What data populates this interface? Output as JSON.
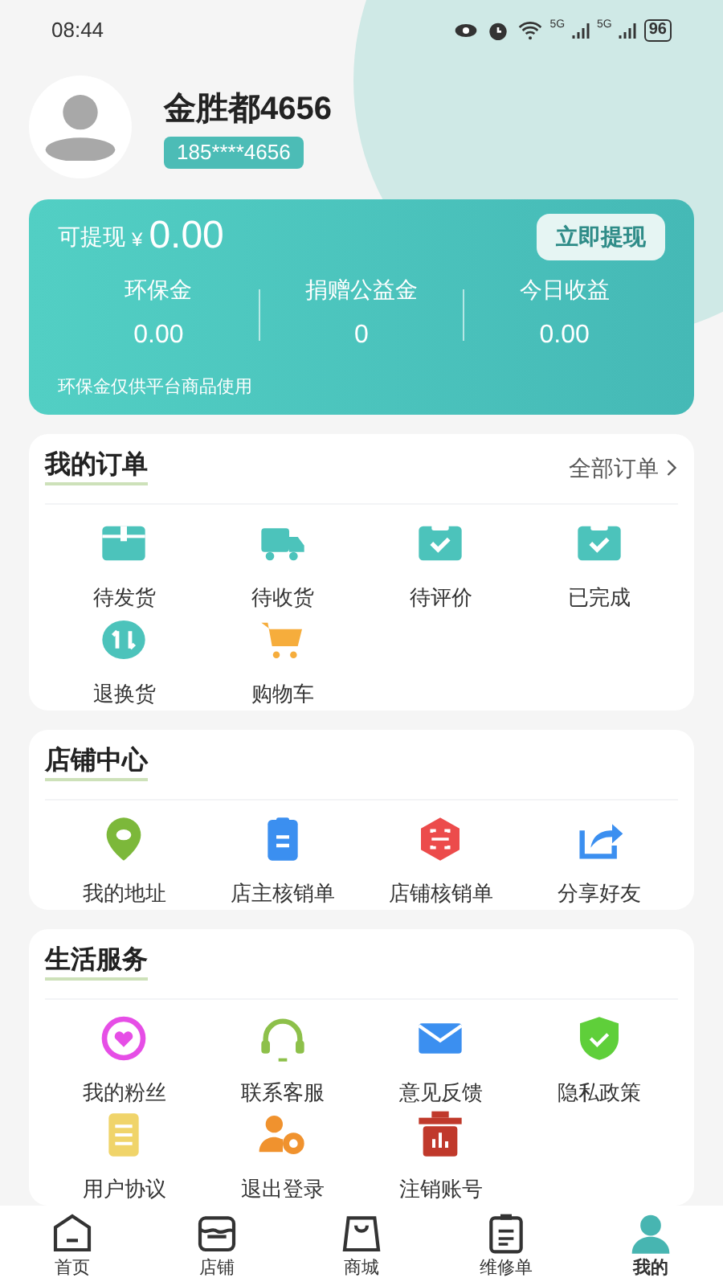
{
  "status_bar": {
    "time": "08:44",
    "network_1": "5G",
    "network_2": "5G",
    "battery": "96"
  },
  "profile": {
    "name": "金胜都4656",
    "phone": "185****4656"
  },
  "wallet": {
    "label": "可提现",
    "currency": "¥",
    "amount": "0.00",
    "withdraw_button": "立即提现",
    "stats": [
      {
        "label": "环保金",
        "value": "0.00"
      },
      {
        "label": "捐赠公益金",
        "value": "0"
      },
      {
        "label": "今日收益",
        "value": "0.00"
      }
    ],
    "note": "环保金仅供平台商品使用"
  },
  "orders": {
    "title": "我的订单",
    "more": "全部订单",
    "items": [
      "待发货",
      "待收货",
      "待评价",
      "已完成",
      "退换货",
      "购物车"
    ]
  },
  "store_center": {
    "title": "店铺中心",
    "items": [
      "我的地址",
      "店主核销单",
      "店铺核销单",
      "分享好友"
    ]
  },
  "life_services": {
    "title": "生活服务",
    "items": [
      "我的粉丝",
      "联系客服",
      "意见反馈",
      "隐私政策",
      "用户协议",
      "退出登录",
      "注销账号"
    ]
  },
  "bottom_nav": [
    {
      "label": "首页",
      "selected": false
    },
    {
      "label": "店铺",
      "selected": false
    },
    {
      "label": "商城",
      "selected": false
    },
    {
      "label": "维修单",
      "selected": false
    },
    {
      "label": "我的",
      "selected": true
    }
  ]
}
